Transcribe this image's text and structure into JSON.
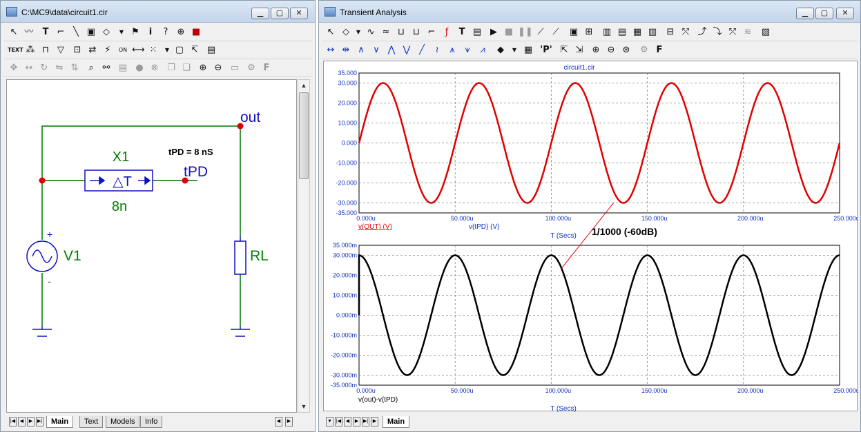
{
  "schematic_window": {
    "title": "C:\\MC9\\data\\circuit1.cir",
    "controls": {
      "minimize": "▁",
      "maximize": "▢",
      "close": "✕"
    },
    "tabs": [
      "Main",
      "Text",
      "Models",
      "Info"
    ],
    "active_tab": "Main",
    "circuit": {
      "node_out": "out",
      "node_tpd": "tPD",
      "delay_name": "X1",
      "delay_symbol": "△T",
      "delay_value": "8n",
      "delay_note": "tPD = 8 nS",
      "source_name": "V1",
      "source_plus": "+",
      "source_minus": "-",
      "load_name": "RL"
    }
  },
  "analysis_window": {
    "title": "Transient Analysis",
    "controls": {
      "minimize": "▁",
      "maximize": "▢",
      "close": "✕"
    },
    "tabs": [
      "Main"
    ],
    "active_tab": "Main",
    "annotation": "1/1000 (-60dB)",
    "colors": {
      "upper_trace": "#e00000",
      "lower_trace": "#000000",
      "grid": "#808080"
    }
  },
  "chart_data": [
    {
      "type": "line",
      "title": "circuit1.cir",
      "xlabel": "T (Secs)",
      "xlim": [
        0,
        250
      ],
      "ylim": [
        -35,
        35
      ],
      "x_ticks": [
        "0.000u",
        "50.000u",
        "100.000u",
        "150.000u",
        "200.000u",
        "250.000u"
      ],
      "y_ticks": [
        "35.000",
        "30.000",
        "20.000",
        "10.000",
        "0.000",
        "-10.000",
        "-20.000",
        "-30.000",
        "-35.000"
      ],
      "series": [
        {
          "name": "v(OUT) (V)",
          "amplitude": 30,
          "frequency_khz": 20,
          "phase_deg": 0
        },
        {
          "name": "v(tPD) (V)",
          "amplitude": 30,
          "frequency_khz": 20,
          "phase_deg": 0
        }
      ],
      "grid": true
    },
    {
      "type": "line",
      "xlabel": "T (Secs)",
      "xlim": [
        0,
        250
      ],
      "ylim": [
        -35,
        35
      ],
      "x_ticks": [
        "0.000u",
        "50.000u",
        "100.000u",
        "150.000u",
        "200.000u",
        "250.000u"
      ],
      "y_ticks": [
        "35.000m",
        "30.000m",
        "20.000m",
        "10.000m",
        "0.000m",
        "-10.000m",
        "-20.000m",
        "-30.000m",
        "-35.000m"
      ],
      "series": [
        {
          "name": "v(out)-v(tPD)",
          "amplitude": 30,
          "frequency_khz": 20,
          "phase_deg": 90
        }
      ],
      "grid": true
    }
  ]
}
